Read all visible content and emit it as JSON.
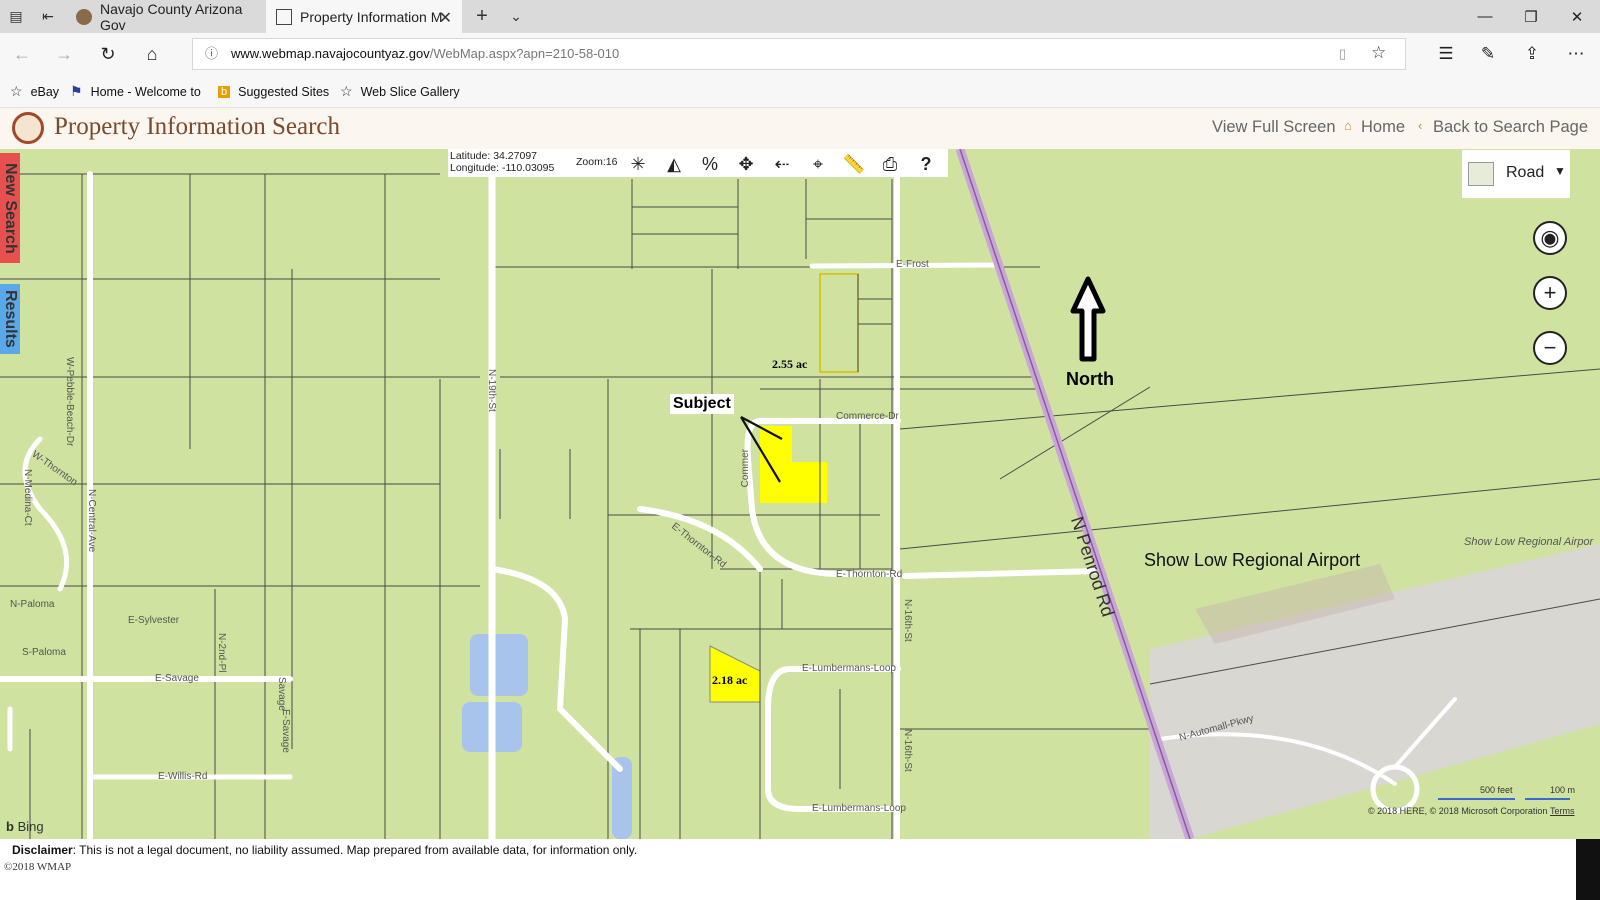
{
  "browser": {
    "tabs": [
      {
        "label": "Navajo County Arizona Gov"
      },
      {
        "label": "Property Information M"
      }
    ],
    "url": {
      "host": "www.webmap.navajocountyaz.gov",
      "path": "/WebMap.aspx?apn=210-58-010"
    },
    "favorites": [
      "eBay",
      "Home - Welcome to",
      "Suggested Sites",
      "Web Slice Gallery"
    ],
    "icons": [
      "tab-actions-icon",
      "back-tabs-icon",
      "new-tab-icon",
      "tab-list-icon",
      "minimize-icon",
      "restore-icon",
      "close-icon",
      "back-icon",
      "forward-icon",
      "refresh-icon",
      "home-icon",
      "info-icon",
      "reading-view-icon",
      "favorite-star-icon",
      "favorites-hub-icon",
      "pen-icon",
      "share-icon",
      "more-icon"
    ]
  },
  "app": {
    "title": "Property Information Search",
    "links": {
      "full_screen": "View Full Screen",
      "home": "Home",
      "back": "Back to Search Page"
    },
    "side_tabs": {
      "new_search": "New Search",
      "results": "Results"
    }
  },
  "map": {
    "latitude_label": "Latitude: 34.27097",
    "longitude_label": "Longitude: -110.03095",
    "zoom_label": "Zoom:16",
    "tool_icons": [
      "identify-pointer-icon",
      "select-shape-icon",
      "percent-icon",
      "pan-icon",
      "back-extent-icon",
      "coordinate-icon",
      "measure-ruler-icon",
      "print-icon",
      "help-icon"
    ],
    "basemap": "Road",
    "control_icons": [
      "locate-icon",
      "zoom-in-icon",
      "zoom-out-icon"
    ],
    "colors": {
      "land": "#cfe2a0",
      "road": "#ffffff",
      "parcel_line": "#4a4a4a",
      "highlight": "#ffff00",
      "water": "#a8c4ec",
      "airport": "#d9d7d2",
      "highway": "#c9a6d6"
    },
    "annotations": {
      "subject": "Subject",
      "north": "North",
      "acres_top": "2.55 ac",
      "acres_bottom": "2.18 ac",
      "airport": "Show Low Regional Airport",
      "airport_small": "Show Low Regional Airpor"
    },
    "street_labels": [
      "E-Frost",
      "Commerce-Dr",
      "Commer",
      "E-Thornton-Rd",
      "E-Thornton-Rd",
      "N-16th-St",
      "N-19th-St",
      "E-Lumbermans-Loop",
      "E-Lumbermans-Loop",
      "N-16th-St",
      "N Penrod Rd",
      "N-Automall-Pkwy",
      "W-Pebble-Beach-Dr",
      "W-Thornton",
      "N-Medina-Ct",
      "N-Central-Ave",
      "N-Paloma",
      "E-Sylvester",
      "N-2nd-Pl",
      "S-Paloma",
      "E-Savage",
      "E-Savage",
      "E-Willis-Rd",
      "Savage"
    ],
    "scale": {
      "feet": "500 feet",
      "meters": "100 m"
    },
    "attribution": "© 2018 HERE, © 2018 Microsoft Corporation",
    "terms": "Terms",
    "bing": "Bing"
  },
  "footer": {
    "disclaimer_label": "Disclaimer",
    "disclaimer_text": ": This is not a legal document, no liability assumed. Map prepared from available data, for information only.",
    "copyright": "©2018 WMAP"
  }
}
